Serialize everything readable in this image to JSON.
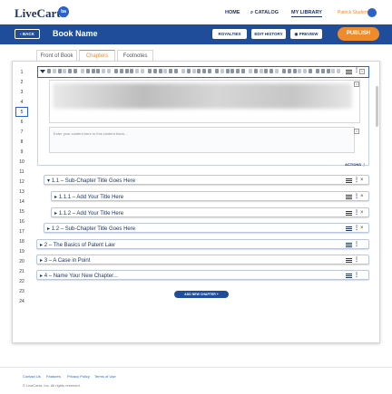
{
  "header": {
    "logo": "LiveCarta",
    "logo_badge": "ba",
    "nav": [
      "HOME",
      "CATALOG",
      "MY LIBRARY"
    ],
    "user_name": "Patrick Student"
  },
  "subheader": {
    "back_label": "BACK",
    "book_title": "Book Name",
    "royalties": "ROYALTIES",
    "edit_history": "EDIT HISTORY",
    "preview": "PREVIEW",
    "publish": "PUBLISH"
  },
  "tabs": [
    "Front of Book",
    "Chapters",
    "Footnotes"
  ],
  "active_tab": "Chapters",
  "line_numbers": [
    "1",
    "2",
    "3",
    "4",
    "5",
    "6",
    "7",
    "8",
    "9",
    "10",
    "11",
    "12",
    "13",
    "14",
    "15",
    "16",
    "17",
    "18",
    "19",
    "20",
    "21",
    "22",
    "23",
    "24"
  ],
  "active_line": "5",
  "editor": {
    "content_placeholder": "Enter your content here to this content block...",
    "actions_label": "ACTIONS"
  },
  "chapters": [
    {
      "label": "1.1 – Sub-Chapter Title Goes Here"
    },
    {
      "label": "1.1.1 – Add Your Title Here"
    },
    {
      "label": "1.1.2 – Add Your Title Here"
    },
    {
      "label": "1.2 – Sub-Chapter Title Goes Here"
    },
    {
      "label": "2 – The Basics of Patent Law"
    },
    {
      "label": "3 – A Case in Point"
    },
    {
      "label": "4 – Name Your New Chapter..."
    }
  ],
  "add_chapter_label": "ADD NEW CHAPTER +",
  "footer": {
    "links": [
      "Contact Us",
      "Features",
      "Privacy Policy",
      "Terms of Use"
    ],
    "copyright": "© LiveCarta, Inc. All rights reserved."
  },
  "colors": {
    "brand_blue": "#1f4d9a",
    "accent_orange": "#f08b2c",
    "navy_text": "#1f3566"
  }
}
